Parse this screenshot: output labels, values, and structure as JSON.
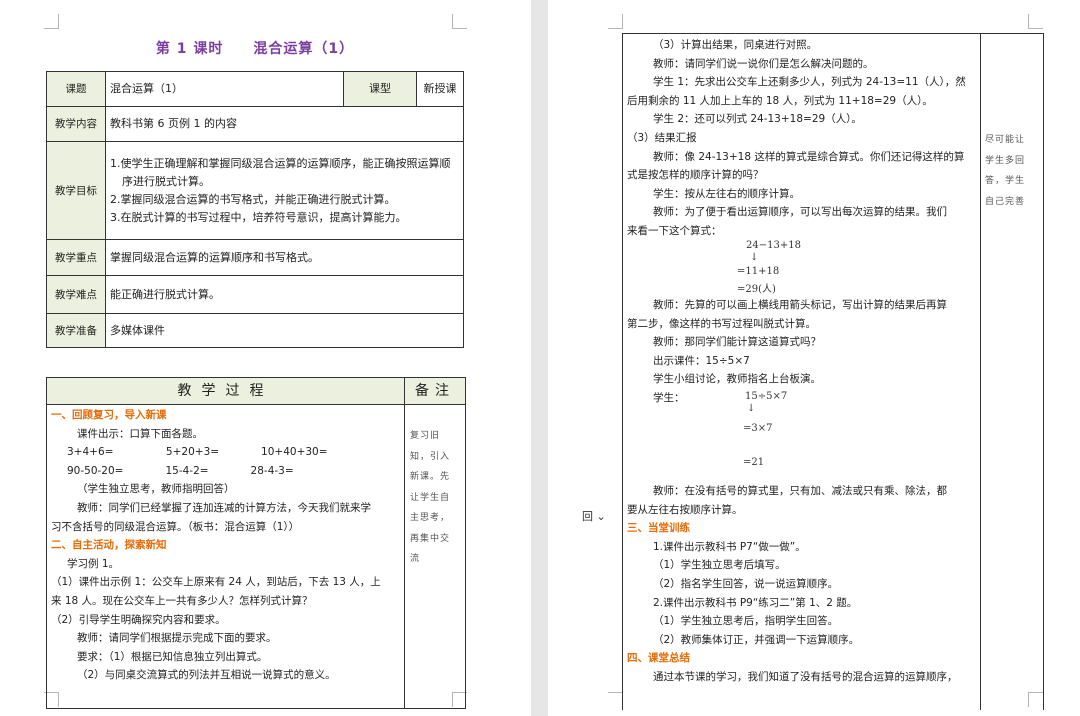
{
  "doc_title": "第 1 课时　　混合运算（1）",
  "info_table": {
    "row1": {
      "label": "课题",
      "value": "混合运算（1）",
      "type_label": "课型",
      "type_value": "新授课"
    },
    "row2": {
      "label": "教学内容",
      "value": "教科书第 6 页例 1 的内容"
    },
    "row3": {
      "label": "教学目标",
      "items": [
        "1.使学生正确理解和掌握同级混合运算的运算顺序，能正确按照运算顺序进行脱式计算。",
        "2.掌握同级混合运算的书写格式，并能正确进行脱式计算。",
        "3.在脱式计算的书写过程中，培养符号意识，提高计算能力。"
      ]
    },
    "row4": {
      "label": "教学重点",
      "value": "掌握同级混合运算的运算顺序和书写格式。"
    },
    "row5": {
      "label": "教学难点",
      "value": "能正确进行脱式计算。"
    },
    "row6": {
      "label": "教学准备",
      "value": "多媒体课件"
    }
  },
  "process_header": {
    "main": "教学过程",
    "note": "备注"
  },
  "left_lines": [
    {
      "t": "一、回顾复习，导入新课",
      "s": "orange"
    },
    {
      "t": "课件出示：口算下面各题。",
      "s": "i1"
    },
    {
      "t": "3+4+6=　　　　　5+20+3=　　　　10+40+30=",
      "s": "i2"
    },
    {
      "t": "90-50-20=　　　　15-4-2=　　　　28-4-3=",
      "s": "i2"
    },
    {
      "t": "（学生独立思考，教师指明回答）",
      "s": "i1"
    },
    {
      "t": "教师：同学们已经掌握了连加连减的计算方法，今天我们就来学",
      "s": "i1"
    },
    {
      "t": "习不含括号的同级混合运算。（板书：混合运算（1））",
      "s": ""
    },
    {
      "t": "二、自主活动，探索新知",
      "s": "orange"
    },
    {
      "t": "学习例 1。",
      "s": "i2"
    },
    {
      "t": "（1）课件出示例 1：公交车上原来有 24 人，到站后，下去 13 人，上",
      "s": ""
    },
    {
      "t": "来 18 人。现在公交车上一共有多少人？怎样列式计算？",
      "s": ""
    },
    {
      "t": "（2）引导学生明确探究内容和要求。",
      "s": ""
    },
    {
      "t": "教师：请同学们根据提示完成下面的要求。",
      "s": "i1"
    },
    {
      "t": "要求：（1）根据已知信息独立列出算式。",
      "s": "i1"
    },
    {
      "t": "（2）与同桌交流算式的列法并互相说一说算式的意义。",
      "s": "i1"
    }
  ],
  "left_note": [
    "复习旧",
    "知，引入",
    "新课。先",
    "让学生自",
    "主思考，",
    "再集中交",
    "流"
  ],
  "right_lines_top": [
    {
      "t": "（3）计算出结果，同桌进行对照。",
      "s": "i1"
    },
    {
      "t": "教师：请同学们说一说你们是怎么解决问题的。",
      "s": "i1"
    },
    {
      "t": "学生 1：先求出公交车上还剩多少人，列式为 24-13=11（人），然",
      "s": "i1"
    },
    {
      "t": "后用剩余的 11 人加上上车的 18 人，列式为 11+18=29（人）。",
      "s": ""
    },
    {
      "t": "学生 2：还可以列式 24-13+18=29（人）。",
      "s": "i1"
    },
    {
      "t": "（3）结果汇报",
      "s": ""
    },
    {
      "t": "教师：像 24-13+18 这样的算式是综合算式。你们还记得这样的算",
      "s": "i1"
    },
    {
      "t": "式是按怎样的顺序计算的吗？",
      "s": ""
    },
    {
      "t": "学生：按从左往右的顺序计算。",
      "s": "i1"
    },
    {
      "t": "教师：为了便于看出运算顺序，可以写出每次运算的结果。我们",
      "s": "i1"
    },
    {
      "t": "来看一下这个算式：",
      "s": ""
    }
  ],
  "calc1": [
    "24−13+18",
    "↓",
    "=11+18",
    "=29(人)"
  ],
  "right_lines_mid": [
    {
      "t": "教师：先算的可以画上横线用箭头标记，写出计算的结果后再算",
      "s": "i1"
    },
    {
      "t": "第二步，像这样的书写过程叫脱式计算。",
      "s": ""
    },
    {
      "t": "教师：那同学们能计算这道算式吗？",
      "s": "i1"
    },
    {
      "t": "出示课件：15÷5×7",
      "s": "i1"
    },
    {
      "t": "学生小组讨论，教师指名上台板演。",
      "s": "i1"
    },
    {
      "t": "学生：",
      "s": "i1"
    }
  ],
  "calc2": [
    "15÷5×7",
    "↓",
    "=3×7",
    "=21"
  ],
  "right_lines_bot": [
    {
      "t": "教师：在没有括号的算式里，只有加、减法或只有乘、除法，都",
      "s": "i1"
    },
    {
      "t": "要从左往右按顺序计算。",
      "s": ""
    },
    {
      "t": "三、当堂训练",
      "s": "orange"
    },
    {
      "t": "1.课件出示教科书 P7“做一做”。",
      "s": "i1"
    },
    {
      "t": "（1）学生独立思考后填写。",
      "s": "i1"
    },
    {
      "t": "（2）指名学生回答，说一说运算顺序。",
      "s": "i1"
    },
    {
      "t": "2.课件出示教科书 P9“练习二”第 1、2 题。",
      "s": "i1"
    },
    {
      "t": "（1）学生独立思考后，指明学生回答。",
      "s": "i1"
    },
    {
      "t": "（2）教师集体订正，并强调一下运算顺序。",
      "s": "i1"
    },
    {
      "t": "四、课堂总结",
      "s": "orange"
    },
    {
      "t": "通过本节课的学习，我们知道了没有括号的混合运算的运算顺序，",
      "s": "i1"
    }
  ],
  "right_note": [
    "尽可能让",
    "学生多回",
    "答，学生",
    "自己完善"
  ],
  "side_control": "回 ⌄"
}
